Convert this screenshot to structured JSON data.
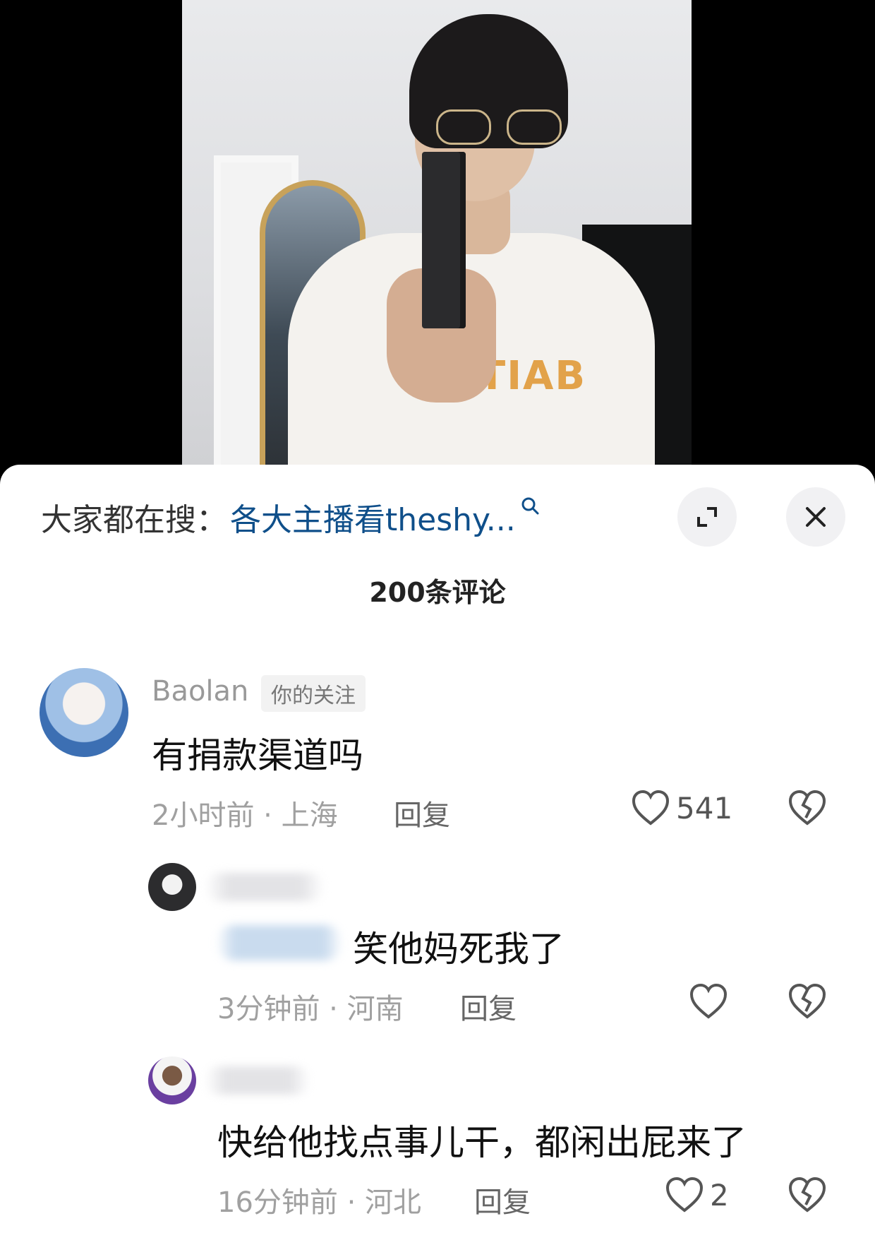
{
  "video": {
    "shirt_print": "TIAB"
  },
  "search": {
    "prefix": "大家都在搜：",
    "query": "各大主播看theshy...",
    "icon": "search-icon"
  },
  "header": {
    "comment_count": "200条评论",
    "expand_icon": "expand-icon",
    "close_icon": "close-icon"
  },
  "comments": [
    {
      "user": "Baolan",
      "badge": "你的关注",
      "text": "有捐款渠道吗",
      "time_location": "2小时前 · 上海",
      "reply": "回复",
      "likes": "541"
    },
    {
      "user": "",
      "mention_suffix": "笑他妈死我了",
      "time_location": "3分钟前 · 河南",
      "reply": "回复",
      "likes": ""
    },
    {
      "user": "",
      "text": "快给他找点事儿干，都闲出屁来了",
      "time_location": "16分钟前 · 河北",
      "reply": "回复",
      "likes": "2"
    }
  ],
  "colors": {
    "link": "#0f4f8a",
    "muted": "#a0a0a0",
    "text": "#111111"
  }
}
